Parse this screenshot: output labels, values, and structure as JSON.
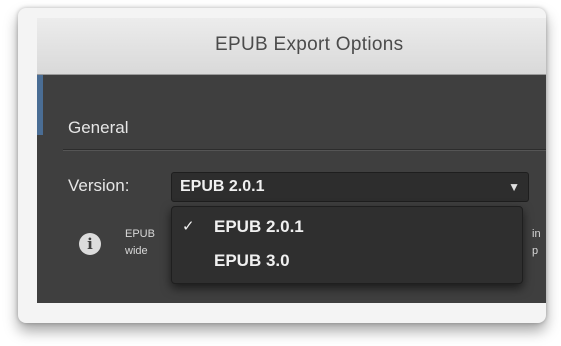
{
  "window": {
    "title": "EPUB Export Options"
  },
  "general": {
    "section_title": "General",
    "version_label": "Version:",
    "version_value": "EPUB 2.0.1",
    "arrow_icon": "chevron-down-icon",
    "options": [
      {
        "label": "EPUB 2.0.1",
        "checked": true
      },
      {
        "label": "EPUB 3.0",
        "checked": false
      }
    ],
    "check_glyph": "✓",
    "info_icon": "info-icon",
    "info_text_left": [
      "EPUB",
      "wide"
    ],
    "info_text_right": [
      "in",
      "p"
    ]
  },
  "colors": {
    "panel_bg": "#3f3f3f",
    "titlebar_bg": "#dcdcdc",
    "selection_accent": "#4a6d94"
  }
}
